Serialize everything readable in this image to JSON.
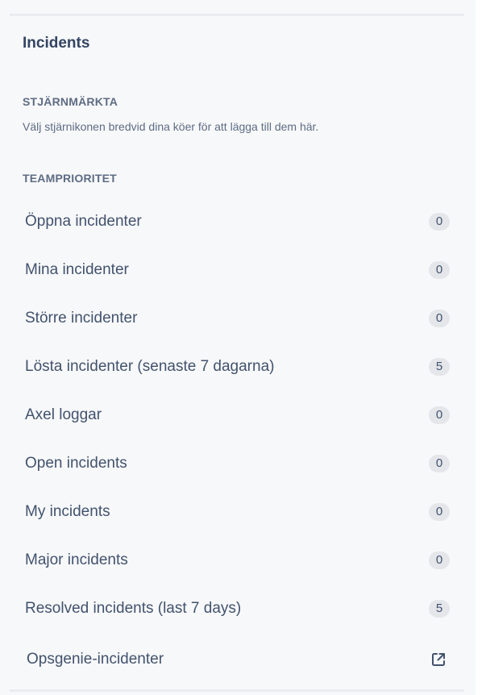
{
  "header": {
    "title": "Incidents"
  },
  "starred": {
    "heading": "STJÄRNMÄRKTA",
    "description": "Välj stjärnikonen bredvid dina köer för att lägga till dem här."
  },
  "team_priority": {
    "heading": "TEAMPRIORITET",
    "queues": [
      {
        "label": "Öppna incidenter",
        "count": "0"
      },
      {
        "label": "Mina incidenter",
        "count": "0"
      },
      {
        "label": "Större incidenter",
        "count": "0"
      },
      {
        "label": "Lösta incidenter (senaste 7 dagarna)",
        "count": "5"
      },
      {
        "label": "Axel loggar",
        "count": "0"
      },
      {
        "label": "Open incidents",
        "count": "0"
      },
      {
        "label": "My incidents",
        "count": "0"
      },
      {
        "label": "Major incidents",
        "count": "0"
      },
      {
        "label": "Resolved incidents (last 7 days)",
        "count": "5"
      }
    ],
    "external_link": {
      "label": "Opsgenie-incidenter",
      "icon": "external-link-icon"
    }
  },
  "colors": {
    "panel_bg": "#f7f8f9",
    "text": "#42526e",
    "muted": "#5e6c84",
    "badge_bg": "#e4e6ea"
  }
}
